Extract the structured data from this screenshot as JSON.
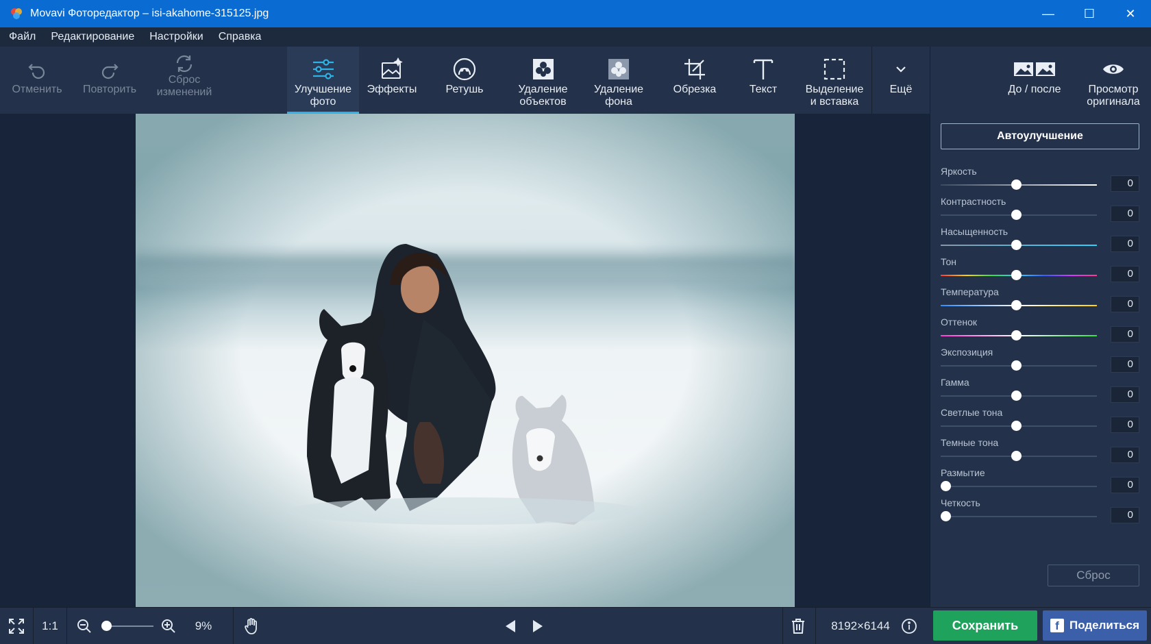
{
  "window": {
    "title": "Movavi Фоторедактор – isi-akahome-315125.jpg",
    "minimize_glyph": "—",
    "maximize_glyph": "☐",
    "close_glyph": "✕"
  },
  "menu": [
    "Файл",
    "Редактирование",
    "Настройки",
    "Справка"
  ],
  "toolbar": {
    "undo": "Отменить",
    "redo": "Повторить",
    "reset_line1": "Сброс",
    "reset_line2": "изменений",
    "tools": [
      {
        "line1": "Улучшение",
        "line2": "фото",
        "icon": "sliders-icon",
        "active": true
      },
      {
        "line1": "Эффекты",
        "line2": "",
        "icon": "effects-icon",
        "active": false
      },
      {
        "line1": "Ретушь",
        "line2": "",
        "icon": "retouch-icon",
        "active": false
      },
      {
        "line1": "Удаление",
        "line2": "объектов",
        "icon": "object-removal-icon",
        "active": false
      },
      {
        "line1": "Удаление",
        "line2": "фона",
        "icon": "background-removal-icon",
        "active": false
      },
      {
        "line1": "Обрезка",
        "line2": "",
        "icon": "crop-icon",
        "active": false
      },
      {
        "line1": "Текст",
        "line2": "",
        "icon": "text-icon",
        "active": false
      },
      {
        "line1": "Выделение",
        "line2": "и вставка",
        "icon": "selection-icon",
        "active": false
      }
    ],
    "more": "Ещё",
    "before_after": "До / после",
    "view_original_line1": "Просмотр",
    "view_original_line2": "оригинала"
  },
  "panel": {
    "auto_enhance": "Автоулучшение",
    "sliders": [
      {
        "label": "Яркость",
        "value": "0",
        "position": 0.5,
        "gradient": "brightness"
      },
      {
        "label": "Контрастность",
        "value": "0",
        "position": 0.5,
        "gradient": "plain"
      },
      {
        "label": "Насыщенность",
        "value": "0",
        "position": 0.5,
        "gradient": "saturation"
      },
      {
        "label": "Тон",
        "value": "0",
        "position": 0.5,
        "gradient": "hue"
      },
      {
        "label": "Температура",
        "value": "0",
        "position": 0.5,
        "gradient": "temperature"
      },
      {
        "label": "Оттенок",
        "value": "0",
        "position": 0.5,
        "gradient": "tint"
      },
      {
        "label": "Экспозиция",
        "value": "0",
        "position": 0.5,
        "gradient": "plain"
      },
      {
        "label": "Гамма",
        "value": "0",
        "position": 0.5,
        "gradient": "plain"
      },
      {
        "label": "Светлые тона",
        "value": "0",
        "position": 0.5,
        "gradient": "plain"
      },
      {
        "label": "Темные тона",
        "value": "0",
        "position": 0.5,
        "gradient": "plain"
      },
      {
        "label": "Размытие",
        "value": "0",
        "position": 0.0,
        "gradient": "plain"
      },
      {
        "label": "Четкость",
        "value": "0",
        "position": 0.0,
        "gradient": "plain"
      }
    ],
    "reset": "Сброс"
  },
  "bottom": {
    "actual_size": "1:1",
    "zoom_percent": "9%",
    "zoom_level": 0.05,
    "dimensions": "8192×6144",
    "save": "Сохранить",
    "share": "Поделиться"
  },
  "colors": {
    "accent": "#2fb3e6",
    "save": "#1fa35c",
    "share": "#3b5fa8",
    "titlebar": "#0a6cd3"
  }
}
